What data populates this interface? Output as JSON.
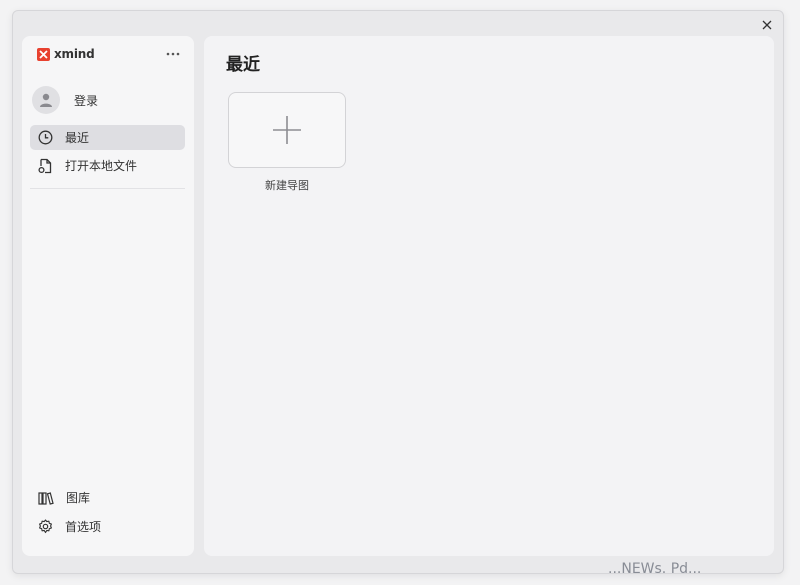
{
  "window": {
    "close_icon": "close-icon"
  },
  "sidebar": {
    "logo_text": "xmind",
    "more_label": "···",
    "login_label": "登录",
    "items": [
      {
        "label": "最近",
        "icon": "clock-icon",
        "active": true
      },
      {
        "label": "打开本地文件",
        "icon": "open-file-icon",
        "active": false
      }
    ],
    "bottom_items": [
      {
        "label": "图库",
        "icon": "library-icon"
      },
      {
        "label": "首选项",
        "icon": "gear-icon"
      }
    ]
  },
  "main": {
    "title": "最近",
    "new_card_label": "新建导图"
  },
  "taskbar": {
    "text": "...NEWs. Pd..."
  },
  "colors": {
    "brand": "#e8412f",
    "active_bg": "#dedee2"
  }
}
